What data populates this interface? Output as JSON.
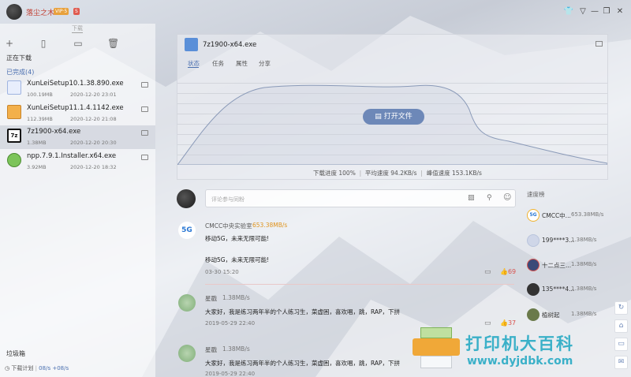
{
  "user": {
    "name": "落尘之木",
    "vip_badge": "VIP·5",
    "extra_badge": "S"
  },
  "topbar": {
    "tab_label": "下载"
  },
  "colors": {
    "accent": "#6d88b8",
    "speed_orange": "#e09520",
    "like_red": "#d9534f"
  },
  "sidebar": {
    "section_downloading": "正在下载",
    "section_completed": "已完成(4)",
    "files": [
      {
        "name": "XunLeiSetup10.1.38.890.exe",
        "size": "100.19MB",
        "date": "2020-12-20 23:01",
        "icon": "xunlei-bird-icon"
      },
      {
        "name": "XunLeiSetup11.1.4.1142.exe",
        "size": "112.39MB",
        "date": "2020-12-20 21:08",
        "icon": "installer-box-icon"
      },
      {
        "name": "7z1900-x64.exe",
        "size": "1.38MB",
        "date": "2020-12-20 20:30",
        "icon": "7zip-icon"
      },
      {
        "name": "npp.7.9.1.Installer.x64.exe",
        "size": "3.92MB",
        "date": "2020-12-20 18:32",
        "icon": "notepadpp-icon"
      }
    ],
    "trash": "垃圾箱",
    "plan_label": "下载计划",
    "down_speed": "08/s",
    "up_speed": "+08/s"
  },
  "detail": {
    "title": "7z1900-x64.exe",
    "tabs": [
      "状态",
      "任务",
      "属性",
      "分享"
    ],
    "open_button": "打开文件",
    "progress_label": "下载进度 100%",
    "avg_speed_label": "平均速度 94.2KB/s",
    "peak_speed_label": "峰值速度 153.1KB/s",
    "progress": 1.0
  },
  "comment_input": {
    "placeholder": "评论参与同粉"
  },
  "comments": [
    {
      "name": "CMCC中央实验室",
      "speed": "653.38MB/s",
      "lines": [
        "移动5G，未来无限可能!",
        "移动5G，未来无限可能!"
      ],
      "time": "03-30 15:20",
      "likes": "69"
    },
    {
      "name": "星戳",
      "speed": "1.38MB/s",
      "lines": [
        "大家好，我是练习两年半的个人练习生，菜虚困，喜欢唱，跳，RAP，下拼"
      ],
      "time": "2019-05-29 22:40",
      "likes": "37"
    },
    {
      "name": "星戳",
      "speed": "1.38MB/s",
      "lines": [
        "大家好，我是练习两年半的个人练习生，菜虚困，喜欢唱，跳，RAP，下拼"
      ],
      "time": "2019-05-29 22:40",
      "likes": ""
    }
  ],
  "ranking": {
    "title": "速度榜",
    "rows": [
      {
        "name": "CMCC中...",
        "speed": "653.38MB/s"
      },
      {
        "name": "199****3...",
        "speed": "1.38MB/s"
      },
      {
        "name": "十二点三...",
        "speed": "1.38MB/s"
      },
      {
        "name": "135****4...",
        "speed": "1.38MB/s"
      },
      {
        "name": "植树起",
        "speed": "1.38MB/s"
      }
    ]
  },
  "watermark": {
    "text": "打印机大百科",
    "url": "www.dyjdbk.com"
  }
}
